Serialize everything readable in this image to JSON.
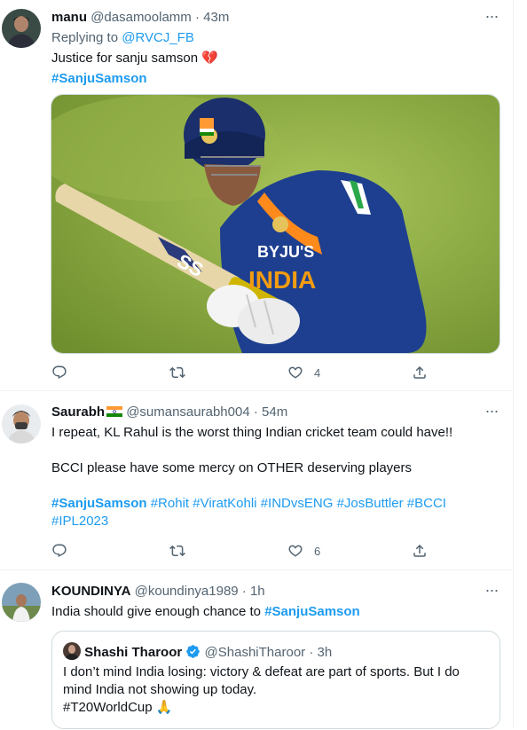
{
  "tweets": [
    {
      "name": "manu",
      "handle": "@dasamoolamm",
      "time": "· 43m",
      "reply_prefix": "Replying to ",
      "reply_to": "@RVCJ_FB",
      "text": "Justice for sanju samson",
      "emoji": "💔",
      "hashtag": "#SanjuSamson",
      "likes": "4"
    },
    {
      "name": "Saurabh",
      "handle": "@sumansaurabh004",
      "time": "· 54m",
      "line1": "I repeat, KL Rahul is the worst thing Indian cricket team could have!!",
      "line2": "BCCI please have some mercy on OTHER deserving players",
      "hashtags": [
        "#SanjuSamson",
        "#Rohit",
        "#ViratKohli",
        "#INDvsENG",
        "#JosButtler",
        "#BCCI",
        "#IPL2023"
      ],
      "likes": "6"
    },
    {
      "name": "KOUNDINYA",
      "handle": "@koundinya1989",
      "time": "· 1h",
      "text": "India should give enough chance to ",
      "hashtag": "#SanjuSamson",
      "quote": {
        "name": "Shashi Tharoor",
        "handle": "@ShashiTharoor",
        "time": "· 3h",
        "line1": "I don’t mind India losing: victory & defeat are part of sports. But I do",
        "line2": "mind India not showing up today.",
        "line3": "#T20WorldCup",
        "emoji": "🙏"
      }
    }
  ],
  "photo": {
    "jersey_text": "INDIA",
    "sponsor_text": "BYJU'S",
    "bat_text": "SS"
  },
  "colors": {
    "accent": "#1d9bf0",
    "muted": "#536471",
    "border": "#cfd9de",
    "divider": "#eff3f4"
  },
  "icons": [
    "more-icon",
    "reply-icon",
    "retweet-icon",
    "like-icon",
    "share-icon",
    "verified-icon",
    "india-flag-icon"
  ]
}
